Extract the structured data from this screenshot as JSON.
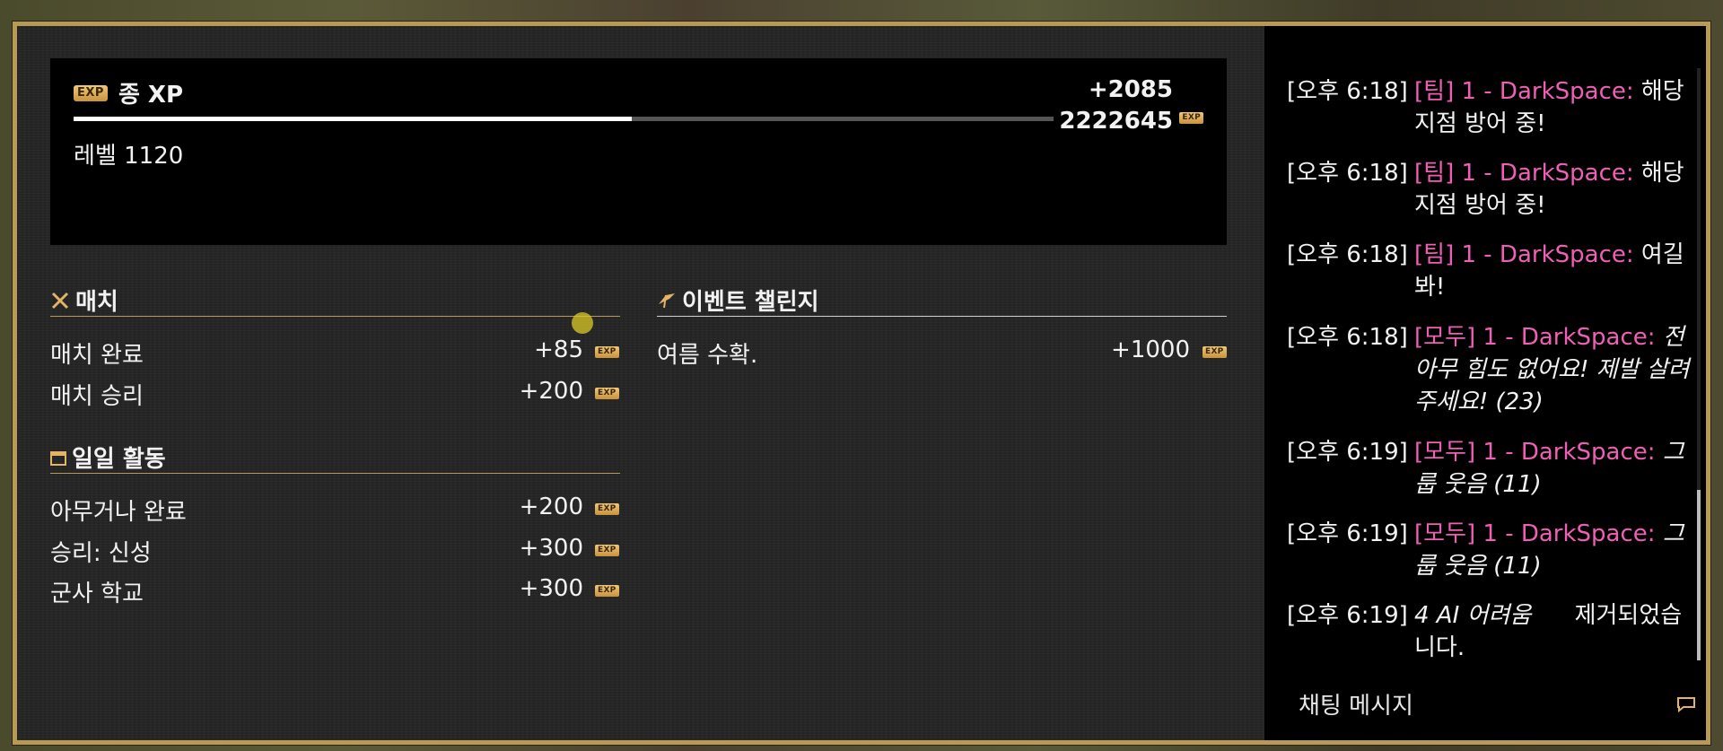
{
  "xp": {
    "badge": "EXP",
    "title": "종 XP",
    "gain": "+2085",
    "total": "2222645",
    "level": "레벨 1120",
    "progress": 0.57
  },
  "match": {
    "title": "매치",
    "rows": [
      {
        "label": "매치 완료",
        "value": "+85"
      },
      {
        "label": "매치 승리",
        "value": "+200"
      }
    ]
  },
  "daily": {
    "title": "일일 활동",
    "rows": [
      {
        "label": "아무거나 완료",
        "value": "+200"
      },
      {
        "label": "승리: 신성",
        "value": "+300"
      },
      {
        "label": "군사 학교",
        "value": "+300"
      }
    ]
  },
  "event": {
    "title": "이벤트 챌린지",
    "rows": [
      {
        "label": "여름 수확.",
        "value": "+1000"
      }
    ]
  },
  "chat": {
    "messages": [
      {
        "time": "[오후 6:18]",
        "channel": "[팀] 1 - DarkSpace:",
        "text": "해당 지점 방어 중!",
        "italic": false
      },
      {
        "time": "[오후 6:18]",
        "channel": "[팀] 1 - DarkSpace:",
        "text": "해당 지점 방어 중!",
        "italic": false
      },
      {
        "time": "[오후 6:18]",
        "channel": "[팀] 1 - DarkSpace:",
        "text": "여길 봐!",
        "italic": false
      },
      {
        "time": "[오후 6:18]",
        "channel": "[모두] 1 - DarkSpace:",
        "text": "전 아무 힘도 없어요! 제발 살려 주세요! (23)",
        "italic": true
      },
      {
        "time": "[오후 6:19]",
        "channel": "[모두] 1 - DarkSpace:",
        "text": "그룹 웃음 (11)",
        "italic": true
      },
      {
        "time": "[오후 6:19]",
        "channel": "[모두] 1 - DarkSpace:",
        "text": "그룹 웃음 (11)",
        "italic": true
      },
      {
        "time": "[오후 6:19]",
        "channel": "",
        "text_italic": "4 AI 어려움",
        "text": "제거되었습니다.",
        "italic": false
      }
    ],
    "input_placeholder": "채팅 메시지"
  },
  "colors": {
    "accent_gold": "#b79a55",
    "chat_channel": "#ef5fb6"
  }
}
